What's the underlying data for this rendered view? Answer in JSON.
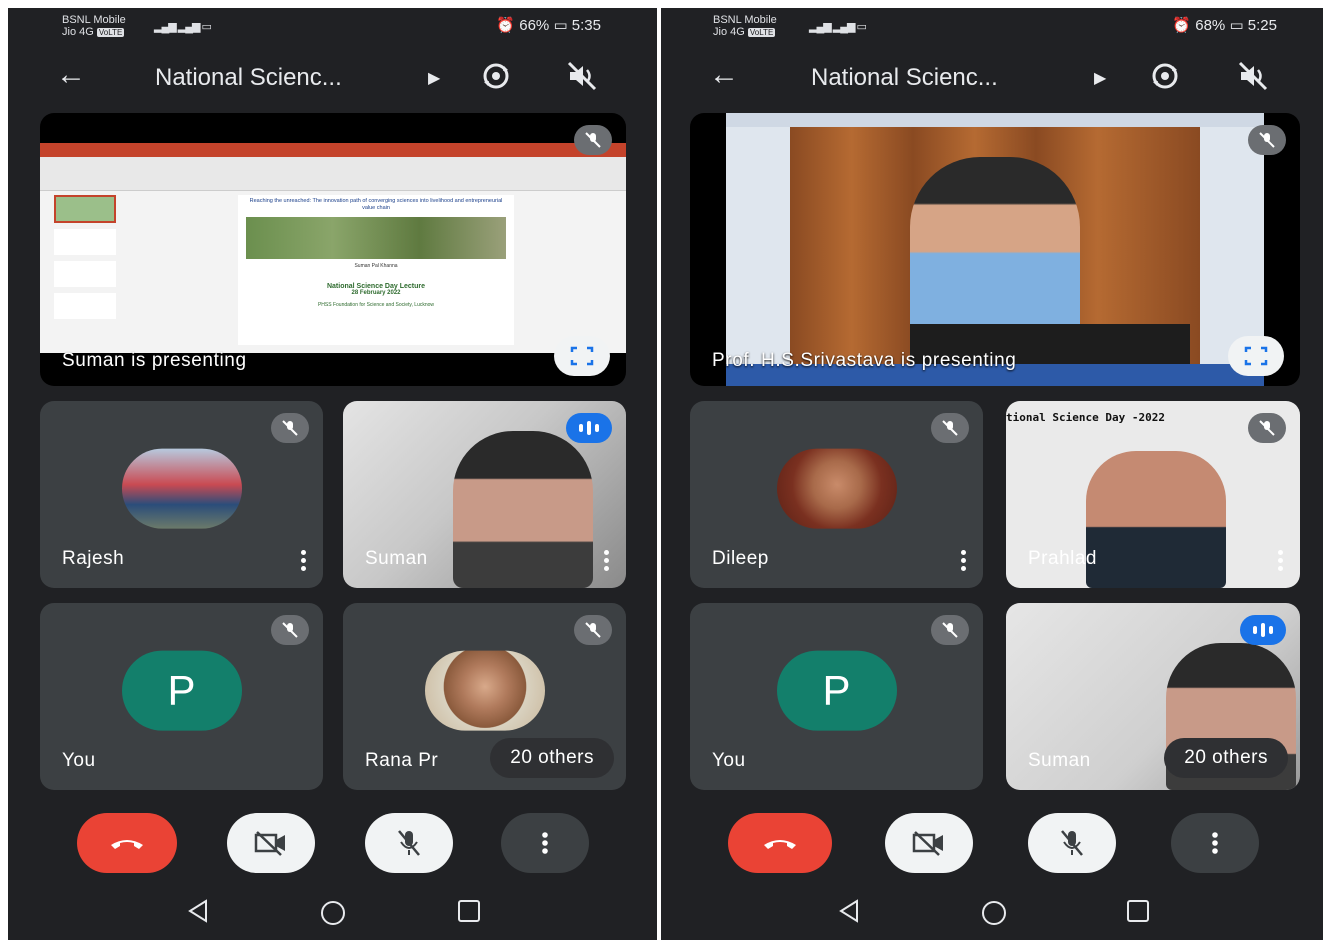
{
  "left_phone": {
    "status": {
      "carrier_line1": "BSNL Mobile",
      "carrier_line2": "Jio 4G",
      "volte": "VoLTE",
      "battery": "66%",
      "time": "5:35"
    },
    "header": {
      "title": "National Scienc..."
    },
    "presentation": {
      "label": "Suman is presenting",
      "slide_title": "Reaching the unreached: The innovation path of converging sciences into livelihood and entrepreneurial value chain",
      "slide_speaker": "Suman Pal Khanna",
      "slide_event": "National Science Day Lecture",
      "slide_date": "28 February 2022",
      "slide_org": "PHSS Foundation for Science and Society, Lucknow"
    },
    "tiles": [
      {
        "name": "Rajesh"
      },
      {
        "name": "Suman"
      },
      {
        "name": "You",
        "initial": "P"
      },
      {
        "name": "Rana Pr",
        "others": "20 others"
      }
    ]
  },
  "right_phone": {
    "status": {
      "carrier_line1": "BSNL Mobile",
      "carrier_line2": "Jio 4G",
      "volte": "VoLTE",
      "battery": "68%",
      "time": "5:25"
    },
    "header": {
      "title": "National Scienc..."
    },
    "presentation": {
      "label": "Prof. H.S.Srivastava is presenting"
    },
    "tiles": [
      {
        "name": "Dileep"
      },
      {
        "name": "Prahlad",
        "banner_text": "tional  Science  Day -2022"
      },
      {
        "name": "You",
        "initial": "P"
      },
      {
        "name": "Suman",
        "others": "20 others"
      }
    ]
  },
  "colors": {
    "background": "#202124",
    "tile": "#3c4043",
    "end_call": "#ea4335",
    "speaking": "#1a73e8",
    "avatar_p": "#137f6b"
  },
  "icons": [
    "back-arrow-icon",
    "flip-camera-icon",
    "speaker-off-icon",
    "mic-off-icon",
    "fullscreen-icon",
    "more-vert-icon",
    "end-call-icon",
    "camera-off-icon",
    "nav-back-icon",
    "nav-home-icon",
    "nav-recents-icon"
  ]
}
